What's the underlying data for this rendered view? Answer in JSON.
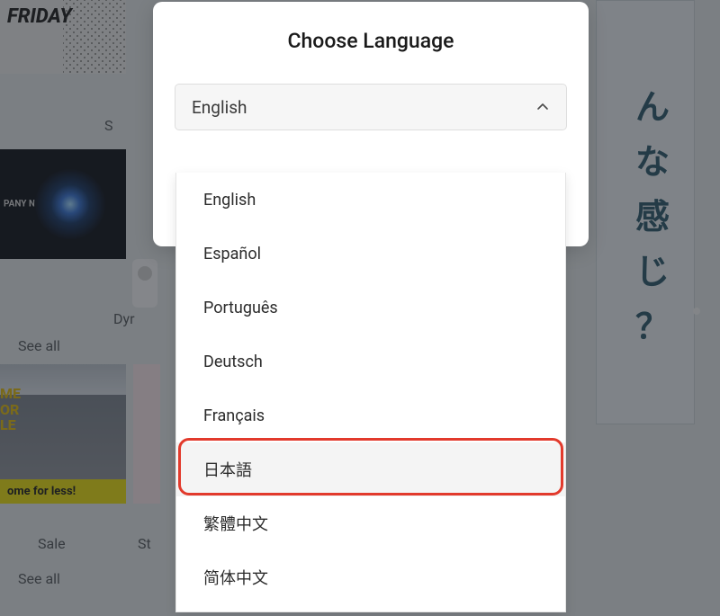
{
  "modal": {
    "title": "Choose Language",
    "selected": "English"
  },
  "options": [
    "English",
    "Español",
    "Português",
    "Deutsch",
    "Français",
    "日本語",
    "繁體中文",
    "简体中文"
  ],
  "highlighted_index": 5,
  "background": {
    "friday_text": "FRIDAY",
    "corp_text": "PANY NAME",
    "room_text1": "ME",
    "room_text2": "OR",
    "room_text3": "LE",
    "room_band": "ome for less!",
    "labels": {
      "seen1": "S",
      "dyr": "Dyr",
      "seeall1": "See all",
      "sale": "Sale",
      "sta": "St",
      "seeall2": "See all"
    },
    "jp_chars": [
      "ん",
      "な",
      "感",
      "じ",
      "？"
    ]
  }
}
